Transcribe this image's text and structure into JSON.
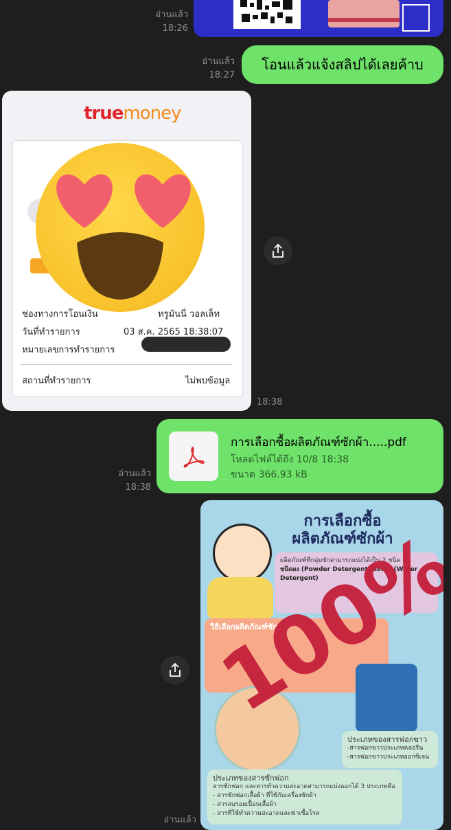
{
  "top_message": {
    "read_label": "อ่านแล้ว",
    "time": "18:26",
    "qr_alt": "qr-code"
  },
  "text_message": {
    "read_label": "อ่านแล้ว",
    "time": "18:27",
    "text": "โอนแล้วแจ้งสลิปได้เลยค้าบ"
  },
  "slip": {
    "logo_true": "true",
    "logo_money": "money",
    "rows": [
      {
        "label": "ช่องทางการโอนเงิน",
        "value": "ทรูมันนี่ วอลเล็ท"
      },
      {
        "label": "วันที่ทำรายการ",
        "value": "03 ส.ค. 2565 18:38:07"
      },
      {
        "label": "หมายเลขการทำรายการ",
        "value": ""
      },
      {
        "label": "สถานที่ทำรายการ",
        "value": "ไม่พบข้อมูล"
      }
    ],
    "time": "18:38"
  },
  "pdf_message": {
    "read_label": "อ่านแล้ว",
    "time": "18:38",
    "filename": "การเลือกซื้อผลิตภัณฑ์ซักผ้า.....pdf",
    "download_until": "โหลดไฟล์ได้ถึง 10/8 18:38",
    "size": "ขนาด 366.93 kB"
  },
  "poster": {
    "title_line1": "การเลือกซื้อ",
    "title_line2": "ผลิตภัณฑ์ซักผ้า",
    "box1_text": "ผลิตภัณฑ์ที่กลุ่มซักสามารถแบ่งได้เป็น 2 ชนิด คือ",
    "box1_bold": "ชนิดผง (Powder Detergent) และน้ำ (Water Detergent)",
    "box2_title": "วิธีเลือกผลิตภัณฑ์ซักผ้า",
    "box3_title": "ประเภทของสารฟอกขาว",
    "box3_items": [
      "-สารฟอกขาวประเภทคลอรีน",
      "-สารฟอกขาวประเภทออกซิเจน"
    ],
    "box4_title": "ประเภทของสารซักฟอก",
    "box4_intro": "สารซักฟอก และสารทำความสะอาดสามารถแบ่งออกได้ 3 ประเภทคือ",
    "box4_items": [
      "- สารซักฟอกเสื้อผ้า ที่ใช้กับเครื่องซักผ้า",
      "- สารลบรอยเปื้อนเสื้อผ้า",
      "- สารที่ใช้ทำความสะอาดและฆ่าเชื้อโรค"
    ],
    "stamp": "100%"
  },
  "bottom_read_label": "อ่านแล้ว"
}
